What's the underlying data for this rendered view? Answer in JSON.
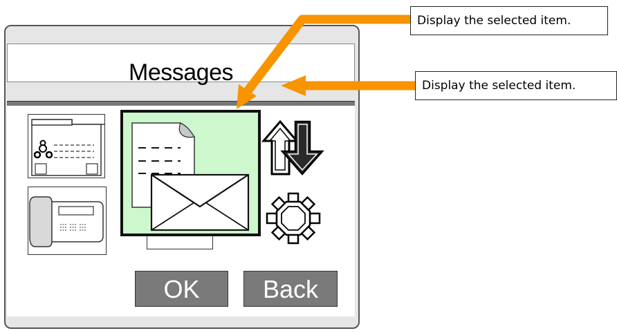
{
  "screen": {
    "title": "Messages",
    "buttons": {
      "ok": "OK",
      "back": "Back"
    },
    "selected_item": "messages",
    "selected_color": "#cdf7cc",
    "icons": [
      "phonebook-icon",
      "telephone-icon",
      "message-icon",
      "transfer-arrows-icon",
      "settings-gear-icon"
    ]
  },
  "callouts": {
    "top": "Display the selected item.",
    "right": "Display the selected item."
  },
  "colors": {
    "arrow": "#f89400",
    "button": "#7a7a7a"
  }
}
